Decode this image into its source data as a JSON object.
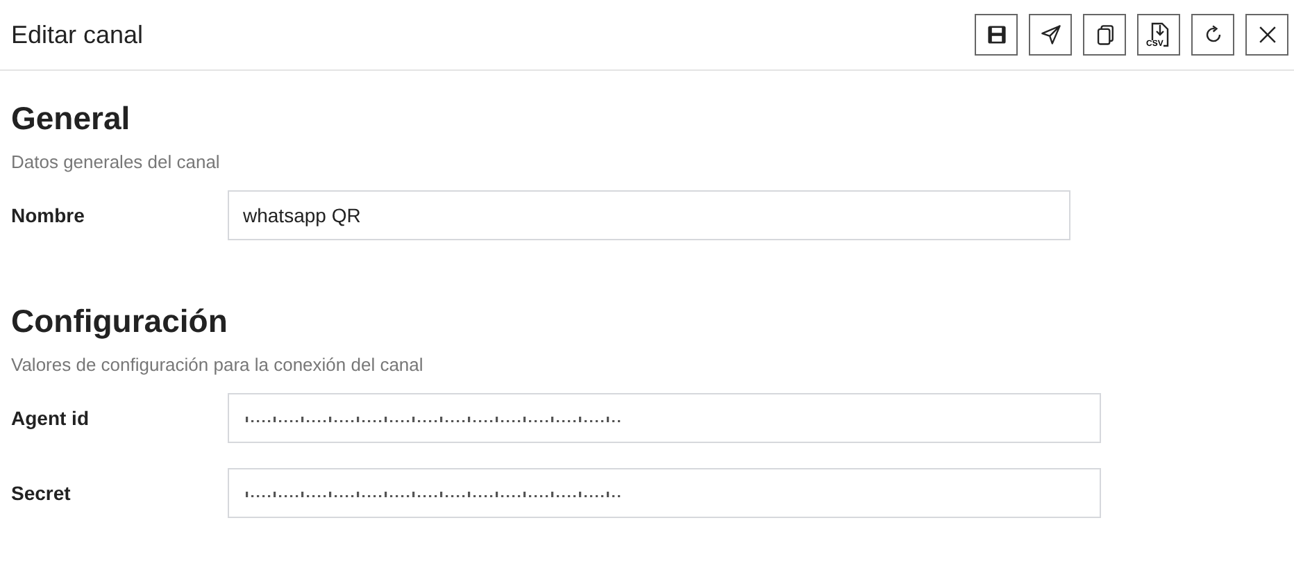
{
  "header": {
    "title": "Editar canal",
    "actions": [
      {
        "kind": "save"
      },
      {
        "kind": "send"
      },
      {
        "kind": "copy"
      },
      {
        "kind": "csv",
        "label": "CSV"
      },
      {
        "kind": "refresh"
      },
      {
        "kind": "close"
      }
    ]
  },
  "sections": [
    {
      "title": "General",
      "subtitle": "Datos generales del canal",
      "fields": [
        {
          "label": "Nombre",
          "kind": "text",
          "value": "whatsapp QR"
        }
      ]
    },
    {
      "title": "Configuración",
      "subtitle": "Valores de configuración para la conexión del canal",
      "fields": [
        {
          "label": "Agent id",
          "kind": "masked"
        },
        {
          "label": "Secret",
          "kind": "masked"
        }
      ]
    }
  ]
}
